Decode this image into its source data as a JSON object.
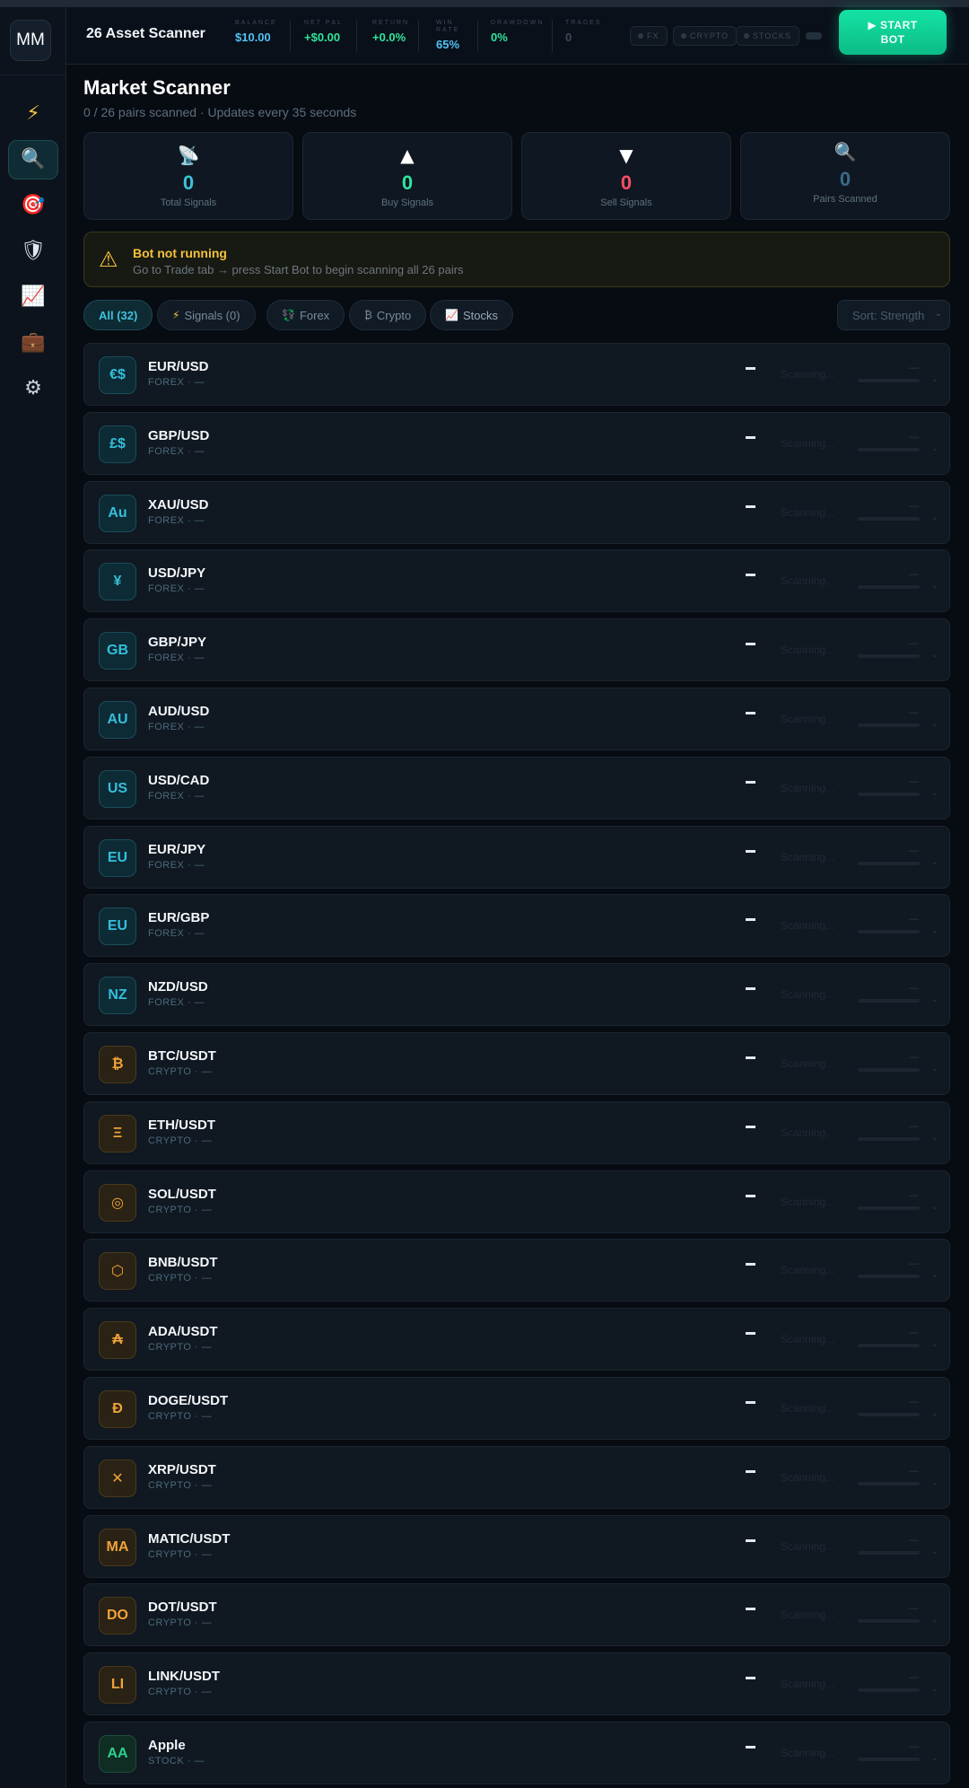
{
  "app": {
    "logo_text": "MM",
    "title": "26 Asset Scanner"
  },
  "sidebar": {
    "items": [
      {
        "name": "trade",
        "icon": "⚡",
        "color": "#f5c13d",
        "active": false
      },
      {
        "name": "scanner",
        "icon": "🔍",
        "color": "#8fd3f4",
        "active": true
      },
      {
        "name": "targets",
        "icon": "🎯",
        "color": "#ff5a5a",
        "active": false
      },
      {
        "name": "risk",
        "icon": "🛡",
        "color": "#e0e6ec",
        "active": false
      },
      {
        "name": "analytics",
        "icon": "📈",
        "color": "#ff6b6b",
        "active": false
      },
      {
        "name": "portfolio",
        "icon": "💼",
        "color": "#d8852e",
        "active": false
      },
      {
        "name": "settings",
        "icon": "⚙",
        "color": "#c8d0d8",
        "active": false
      }
    ]
  },
  "topbar": {
    "stats": [
      {
        "label": "Balance",
        "value": "$10.00",
        "color": "#4fc3f7"
      },
      {
        "label": "Net P&L",
        "value": "+$0.00",
        "color": "#2ee59d"
      },
      {
        "label": "Return",
        "value": "+0.0%",
        "color": "#2ee59d"
      },
      {
        "label": "Win Rate",
        "value": "65%",
        "color": "#4fc3f7"
      },
      {
        "label": "Drawdown",
        "value": "0%",
        "color": "#2ee59d"
      },
      {
        "label": "Trades",
        "value": "0",
        "color": "#3b4a58"
      }
    ],
    "pills": [
      "FX",
      "CRYPTO",
      "STOCKS"
    ],
    "start_label": "▶ START BOT"
  },
  "page": {
    "title": "Market Scanner",
    "subtitle": "0 / 26 pairs scanned · Updates every 35 seconds"
  },
  "cards": [
    {
      "icon": "📡",
      "value": "0",
      "label": "Total Signals",
      "color": "#3fc2dd"
    },
    {
      "icon": "▲",
      "value": "0",
      "label": "Buy Signals",
      "color": "#2ee59d"
    },
    {
      "icon": "▼",
      "value": "0",
      "label": "Sell Signals",
      "color": "#ff4d63"
    },
    {
      "icon": "🔍",
      "value": "0",
      "label": "Pairs Scanned",
      "color": "#3a6a8a"
    }
  ],
  "alert": {
    "icon": "⚠",
    "title": "Bot not running",
    "text": "Go to Trade tab → press Start Bot to begin scanning all 26 pairs"
  },
  "filters": {
    "chips": [
      {
        "label": "All (32)",
        "icon": "",
        "active": true
      },
      {
        "label": "Signals (0)",
        "icon": "⚡",
        "active": false
      },
      {
        "label": "Forex",
        "icon": "💱",
        "active": false
      },
      {
        "label": "Crypto",
        "icon": "₿",
        "active": false
      },
      {
        "label": "Stocks",
        "icon": "📈",
        "active": false
      }
    ],
    "sort_label": "Sort: Strength"
  },
  "scanner": {
    "rows": [
      {
        "symbol": "EUR/USD",
        "badge": "€$",
        "type": "forex",
        "meta": "FOREX · —"
      },
      {
        "symbol": "GBP/USD",
        "badge": "£$",
        "type": "forex",
        "meta": "FOREX · —"
      },
      {
        "symbol": "XAU/USD",
        "badge": "Au",
        "type": "forex",
        "meta": "FOREX · —"
      },
      {
        "symbol": "USD/JPY",
        "badge": "¥",
        "type": "forex",
        "meta": "FOREX · —"
      },
      {
        "symbol": "GBP/JPY",
        "badge": "GB",
        "type": "forex",
        "meta": "FOREX · —"
      },
      {
        "symbol": "AUD/USD",
        "badge": "AU",
        "type": "forex",
        "meta": "FOREX · —"
      },
      {
        "symbol": "USD/CAD",
        "badge": "US",
        "type": "forex",
        "meta": "FOREX · —"
      },
      {
        "symbol": "EUR/JPY",
        "badge": "EU",
        "type": "forex",
        "meta": "FOREX · —"
      },
      {
        "symbol": "EUR/GBP",
        "badge": "EU",
        "type": "forex",
        "meta": "FOREX · —"
      },
      {
        "symbol": "NZD/USD",
        "badge": "NZ",
        "type": "forex",
        "meta": "FOREX · —"
      },
      {
        "symbol": "BTC/USDT",
        "badge": "₿",
        "type": "crypto",
        "meta": "CRYPTO · —"
      },
      {
        "symbol": "ETH/USDT",
        "badge": "Ξ",
        "type": "crypto",
        "meta": "CRYPTO · —"
      },
      {
        "symbol": "SOL/USDT",
        "badge": "◎",
        "type": "crypto",
        "meta": "CRYPTO · —"
      },
      {
        "symbol": "BNB/USDT",
        "badge": "⬡",
        "type": "crypto",
        "meta": "CRYPTO · —"
      },
      {
        "symbol": "ADA/USDT",
        "badge": "₳",
        "type": "crypto",
        "meta": "CRYPTO · —"
      },
      {
        "symbol": "DOGE/USDT",
        "badge": "Ð",
        "type": "crypto",
        "meta": "CRYPTO · —"
      },
      {
        "symbol": "XRP/USDT",
        "badge": "✕",
        "type": "crypto",
        "meta": "CRYPTO · —"
      },
      {
        "symbol": "MATIC/USDT",
        "badge": "MA",
        "type": "crypto",
        "meta": "CRYPTO · —"
      },
      {
        "symbol": "DOT/USDT",
        "badge": "DO",
        "type": "crypto",
        "meta": "CRYPTO · —"
      },
      {
        "symbol": "LINK/USDT",
        "badge": "LI",
        "type": "crypto",
        "meta": "CRYPTO · —"
      },
      {
        "symbol": "Apple",
        "badge": "AA",
        "type": "stock",
        "meta": "STOCK · —"
      }
    ],
    "status_text": "Scanning...",
    "score_text": "—",
    "action_text": "—"
  }
}
